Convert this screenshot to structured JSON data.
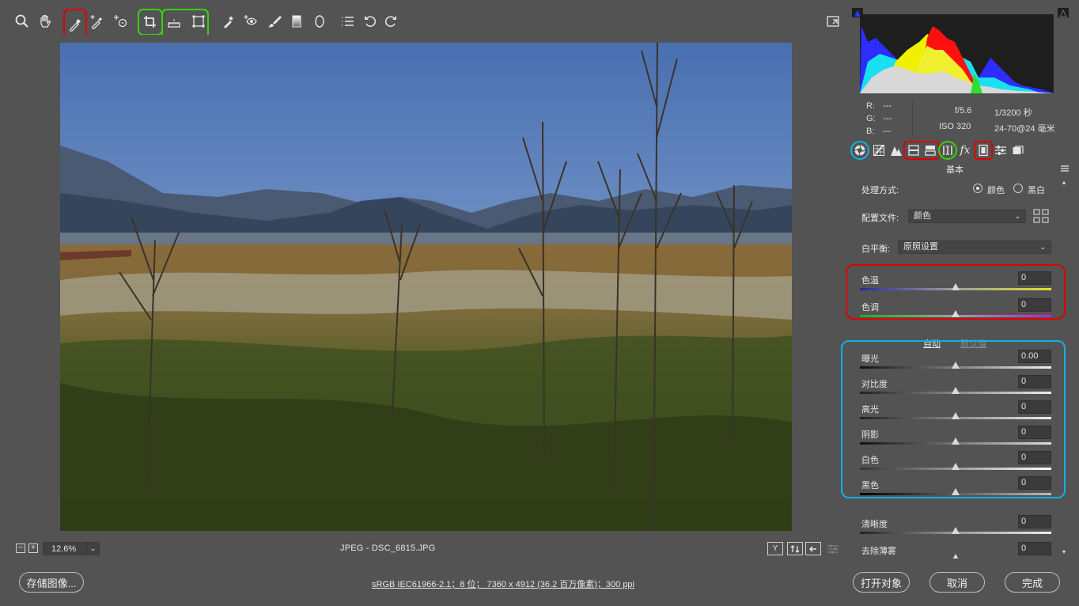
{
  "toolbar": {
    "tools": [
      {
        "name": "zoom-tool",
        "icon": "magnifier-icon"
      },
      {
        "name": "hand-tool",
        "icon": "hand-icon"
      },
      {
        "name": "white-balance-tool",
        "icon": "eyedropper-icon"
      },
      {
        "name": "color-sampler-tool",
        "icon": "eyedropper-plus-icon"
      },
      {
        "name": "targeted-adjustment-tool",
        "icon": "target-adjust-icon"
      },
      {
        "name": "crop-tool",
        "icon": "crop-icon"
      },
      {
        "name": "straighten-tool",
        "icon": "straighten-icon"
      },
      {
        "name": "transform-tool",
        "icon": "transform-icon"
      },
      {
        "name": "spot-removal-tool",
        "icon": "spot-removal-icon"
      },
      {
        "name": "red-eye-tool",
        "icon": "red-eye-icon"
      },
      {
        "name": "adjustment-brush-tool",
        "icon": "brush-icon"
      },
      {
        "name": "graduated-filter-tool",
        "icon": "graduated-filter-icon"
      },
      {
        "name": "radial-filter-tool",
        "icon": "radial-filter-icon"
      },
      {
        "name": "preferences-tool",
        "icon": "list-icon"
      },
      {
        "name": "rotate-ccw-tool",
        "icon": "rotate-ccw-icon"
      },
      {
        "name": "rotate-cw-tool",
        "icon": "rotate-cw-icon"
      },
      {
        "name": "fullscreen-tool",
        "icon": "fullscreen-icon"
      }
    ]
  },
  "status": {
    "zoom": "12.6%",
    "filename": "JPEG -  DSC_6815.JPG",
    "minus": "−",
    "plus": "+",
    "zoom_arrow": "⌄",
    "y_toggle": "Y"
  },
  "info": {
    "r_label": "R:",
    "r_value": "---",
    "g_label": "G:",
    "g_value": "---",
    "b_label": "B:",
    "b_value": "---",
    "aperture": "f/5.6",
    "shutter": "1/3200 秒",
    "iso": "ISO 320",
    "lens": "24-70@24 毫米"
  },
  "panel": {
    "title": "基本",
    "treatment_label": "处理方式:",
    "treatment_color": "颜色",
    "treatment_bw": "黑白",
    "profile_label": "配置文件:",
    "profile_value": "颜色",
    "wb_label": "白平衡:",
    "wb_value": "原照设置",
    "auto": "自动",
    "default": "默认值",
    "sliders": {
      "temp": {
        "label": "色温",
        "value": "0"
      },
      "tint": {
        "label": "色调",
        "value": "0"
      },
      "exposure": {
        "label": "曝光",
        "value": "0.00"
      },
      "contrast": {
        "label": "对比度",
        "value": "0"
      },
      "highlights": {
        "label": "高光",
        "value": "0"
      },
      "shadows": {
        "label": "阴影",
        "value": "0"
      },
      "whites": {
        "label": "白色",
        "value": "0"
      },
      "blacks": {
        "label": "黑色",
        "value": "0"
      },
      "clarity": {
        "label": "清晰度",
        "value": "0"
      },
      "dehaze": {
        "label": "去除薄雾",
        "value": "0"
      }
    }
  },
  "bottom": {
    "save": "存储图像...",
    "file_info": "sRGB IEC61966-2.1；8 位；  7360 x 4912 (36.2 百万像素)；300 ppi",
    "open": "打开对象",
    "cancel": "取消",
    "done": "完成"
  },
  "colors": {
    "annotation_red": "#e00000",
    "annotation_green": "#36d30b",
    "annotation_cyan": "#0fb2e6",
    "panel_bg": "#535353"
  }
}
